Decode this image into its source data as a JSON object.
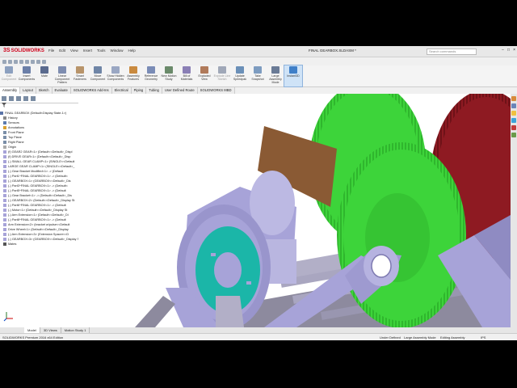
{
  "app": {
    "logo": "SOLIDWORKS",
    "document_title": "FINAL GEARBOX.SLDASM *",
    "search_placeholder": "Search commands",
    "menu": [
      "File",
      "Edit",
      "View",
      "Insert",
      "Tools",
      "Window",
      "Help"
    ],
    "window_controls": [
      "−",
      "□",
      "×"
    ]
  },
  "commands": [
    {
      "label": "Edit Component",
      "icon_color": "#8ca0bf",
      "disabled": true
    },
    {
      "label": "Insert Components",
      "icon_color": "#6b7fa8"
    },
    {
      "label": "Mate",
      "icon_color": "#5a6a8e"
    },
    {
      "label": "Linear Component Pattern",
      "icon_color": "#7e8db0"
    },
    {
      "label": "Smart Fasteners",
      "icon_color": "#b8946a"
    },
    {
      "label": "Move Component",
      "icon_color": "#6f85a6"
    },
    {
      "label": "Show Hidden Components",
      "icon_color": "#9aa7c3"
    },
    {
      "label": "Assembly Features",
      "icon_color": "#c98a3f"
    },
    {
      "label": "Reference Geometry",
      "icon_color": "#7a8cb6"
    },
    {
      "label": "New Motion Study",
      "icon_color": "#6a8a6a"
    },
    {
      "label": "Bill of Materials",
      "icon_color": "#8a7fb5"
    },
    {
      "label": "Exploded View",
      "icon_color": "#b07a5a"
    },
    {
      "label": "Explode Line Sketch",
      "icon_color": "#a0a8b8",
      "disabled": true
    },
    {
      "label": "Update Speedpak",
      "icon_color": "#6b90b8"
    },
    {
      "label": "Take Snapshot",
      "icon_color": "#7d9cc0"
    },
    {
      "label": "Large Assembly Mode",
      "icon_color": "#6a7b96"
    },
    {
      "label": "Instant3D",
      "icon_color": "#3f7fc8",
      "active": true
    }
  ],
  "tabs": [
    "Assembly",
    "Layout",
    "Sketch",
    "Evaluate",
    "SOLIDWORKS Add-Ins",
    "Electrical",
    "Piping",
    "Tubing",
    "User Defined Route",
    "SOLIDWORKS MBD"
  ],
  "tree": {
    "root": "FINAL GEARBOX (Default<Display State-1>)",
    "items": [
      "History",
      "Sensors",
      "Annotations",
      "Front Plane",
      "Top Plane",
      "Right Plane",
      "Origin",
      "(f) GEAR2 GEAR<1> (Default<<Default>_Displ",
      "(f) DRIVE GEAR<1> (Default<<Default>_Disp",
      "(-) SMALL GEAR CLAMP<1> (SINGLE<<Default",
      "LARGE GEAR CLAMP<1> (SINGLE<<Default>_",
      "(-) Gear Bracket Modified<1> -> (Default",
      "(-) Part1^FINAL GEARBOX<1> -> (Default<",
      "(-) GEARBOX<1> (GEARBOX<<Default>_Dis",
      "(-) Part3^FINAL GEARBOX<1> -> (Default<",
      "(-) Part5^FINAL GEARBOX<1> -> (Default",
      "(-) Gear Bracket<1> -> (Default<<Default>_Dis",
      "(-) GEARBOX<2> (Default<<Default>_Display St",
      "(-) Part6^FINAL GEARBOX<1> -> (Default",
      "(-) Motor<1> (Default<<Default>_Display St",
      "(-) Arm Extension<1> (Default<<Default>_Di",
      "(-) Part8^FINAL GEARBOX<1> -> (Default",
      "Arm Extension<2> (bracket w/pulse<<Default",
      "Drive Wheel<1> (Default<<Default>_Display",
      "(-) Arm Extension<3> (Extension Spacer<<D",
      "(-) GEARBOX<3> (GEARBOX<<Default>_Display S",
      "Mates"
    ]
  },
  "bottom_tabs": [
    "Model",
    "3D Views",
    "Motion Study 1"
  ],
  "status": {
    "left": "SOLIDWORKS Premium 2016 x64 Edition",
    "under_defined": "Under Defined",
    "large_mode": "Large Assembly Mode",
    "editing": "Editing Assembly",
    "units": "IPS"
  },
  "colors": {
    "gear_green": "#3dd43a",
    "gear_dark_red": "#8e1a22",
    "housing": "#a7a3d8",
    "teal_face": "#1bb6a8",
    "board": "#8a5a34"
  }
}
